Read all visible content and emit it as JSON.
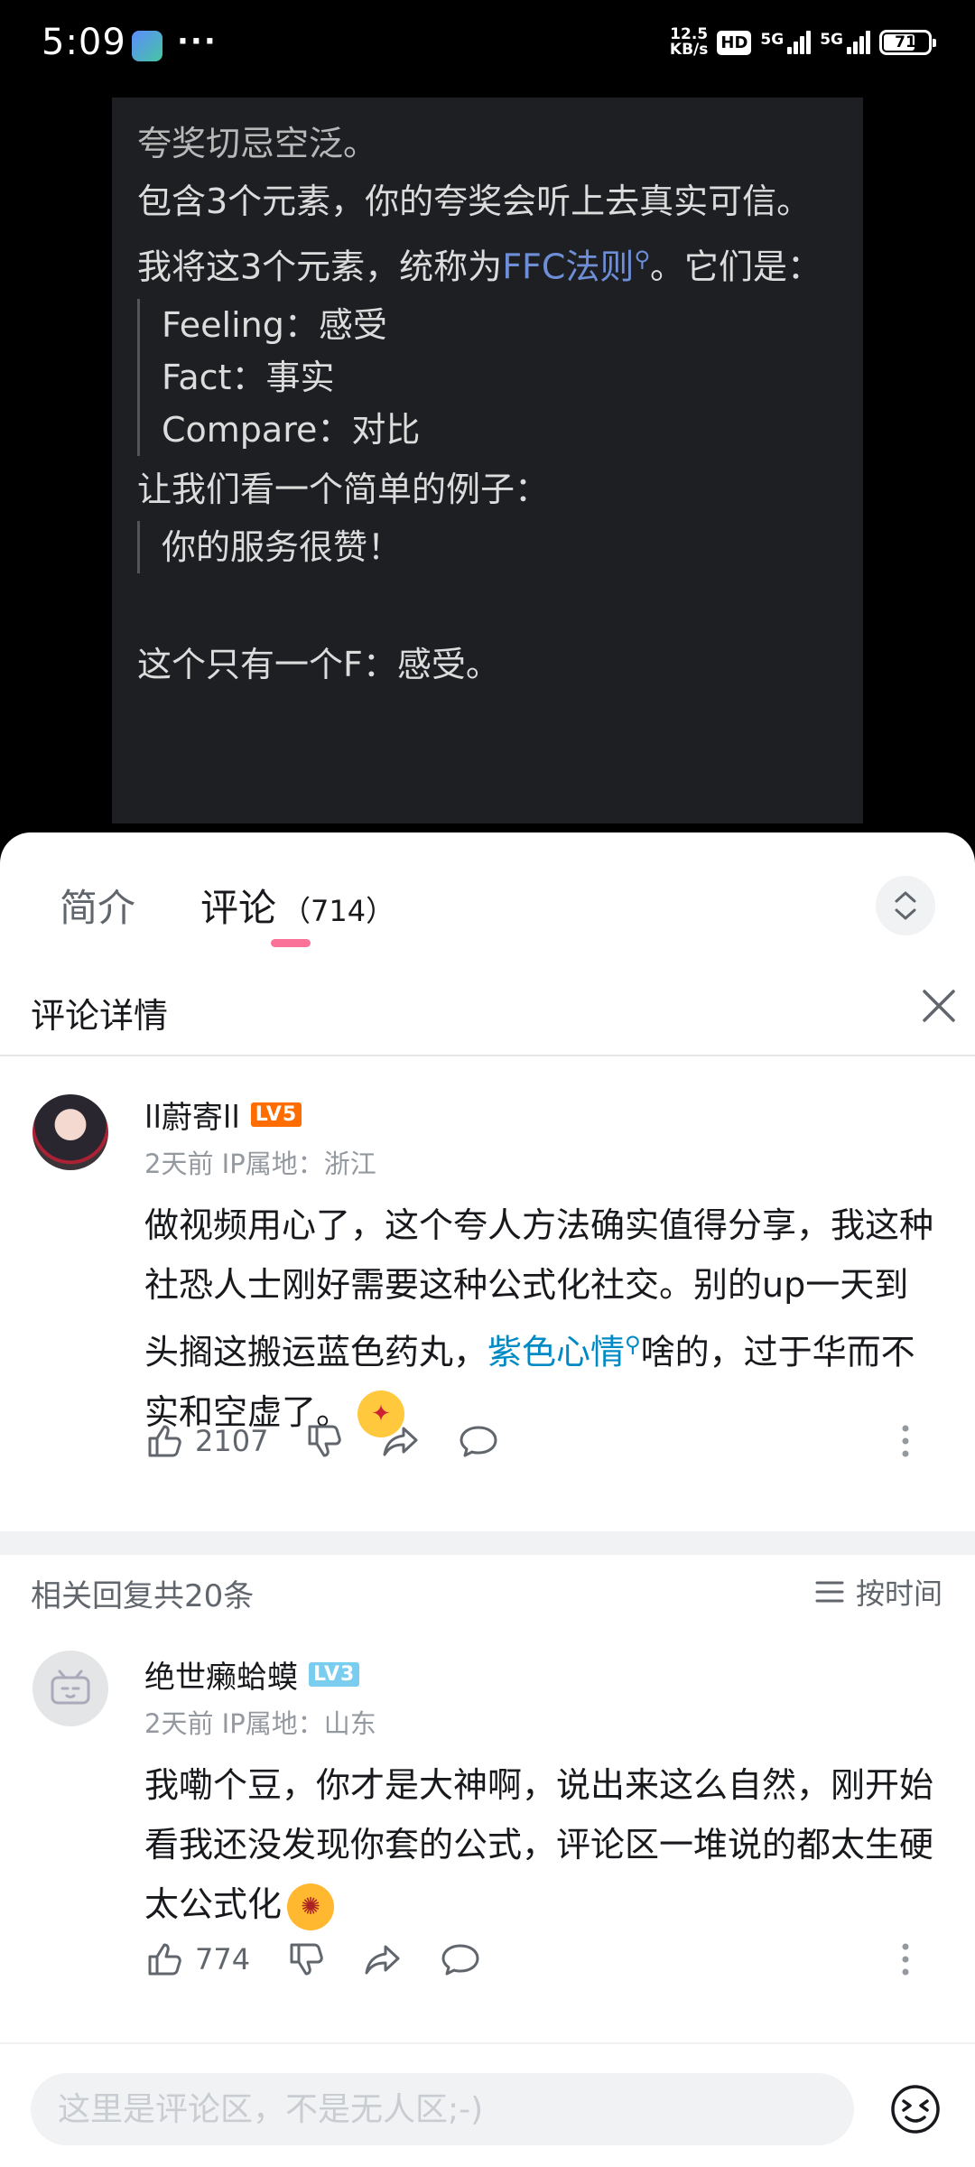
{
  "status": {
    "time": "5:09",
    "more": "···",
    "speed_top": "12.5",
    "speed_bottom": "KB/s",
    "hd": "HD",
    "net1": "5G",
    "net2": "5G",
    "battery": "71"
  },
  "video": {
    "lines": {
      "l1": "夸奖切忌空泛。",
      "l2": "包含3个元素，你的夸奖会听上去真实可信。",
      "l3_pre": "我将这3个元素，统称为",
      "l3_link": "FFC法则",
      "l3_post": "。它们是：",
      "q1": "Feeling：感受",
      "q2": "Fact：事实",
      "q3": "Compare：对比",
      "l4": "让我们看一个简单的例子：",
      "q4": "你的服务很赞！",
      "l5": "这个只有一个F：感受。"
    }
  },
  "tabs": {
    "intro": "简介",
    "comments": "评论",
    "comments_count": "（714）"
  },
  "detail": {
    "title": "评论详情"
  },
  "main_comment": {
    "username": "ll蔚寄ll",
    "level": "LV5",
    "meta": "2天前  IP属地：浙江",
    "text_pre": "做视频用心了，这个夸人方法确实值得分享，我这种社恐人士刚好需要这种公式化社交。别的up一天到头搁这搬运蓝色药丸，",
    "text_link": "紫色心情",
    "text_post": "啥的，过于华而不实和空虚了。",
    "likes": "2107"
  },
  "replies": {
    "count_label": "相关回复共20条",
    "sort_label": "按时间"
  },
  "reply": {
    "username": "绝世癞蛤蟆",
    "level": "LV3",
    "meta": "2天前  IP属地：山东",
    "text": "我嘞个豆，你才是大神啊，说出来这么自然，刚开始看我还没发现你套的公式，评论区一堆说的都太生硬太公式化",
    "likes": "774"
  },
  "input": {
    "placeholder": "这里是评论区，不是无人区;-)"
  },
  "colors": {
    "accent": "#fb7299",
    "link": "#008ac5",
    "level5": "#ff6c00",
    "level3": "#7bcdef"
  }
}
